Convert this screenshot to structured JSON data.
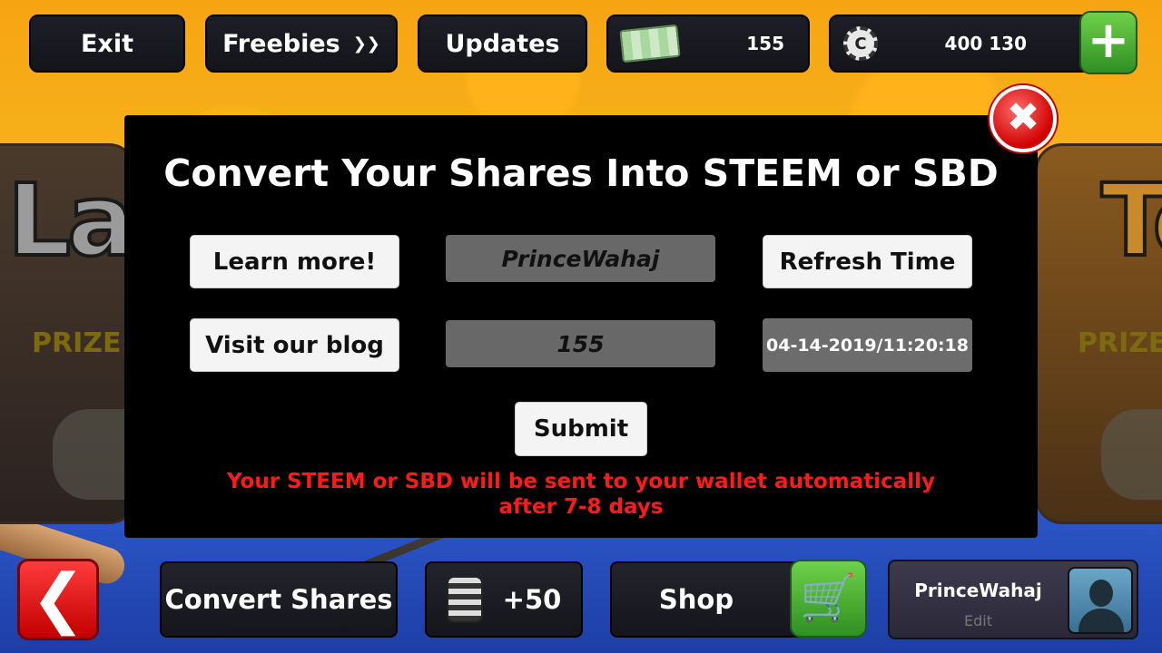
{
  "top_bar": {
    "exit_label": "Exit",
    "freebies_label": "Freebies",
    "updates_label": "Updates",
    "cash_amount": "155",
    "coin_amount": "400 130",
    "plus_symbol": "+",
    "coin_glyph": "C"
  },
  "background": {
    "left_panel_text": "Las",
    "right_panel_text": "To",
    "prize_label": "PRIZE:"
  },
  "modal": {
    "title": "Convert Your Shares Into STEEM or SBD",
    "learn_more_label": "Learn more!",
    "visit_blog_label": "Visit our blog",
    "refresh_time_label": "Refresh Time",
    "username_value": "PrinceWahaj",
    "shares_value": "155",
    "timestamp_value": "04-14-2019/11:20:18",
    "submit_label": "Submit",
    "notice_text": "Your STEEM or SBD will be sent to your wallet automatically after 7-8 days",
    "close_symbol": "✖"
  },
  "bottom_bar": {
    "back_symbol": "❮",
    "convert_shares_label": "Convert Shares",
    "chips_bonus": "+50",
    "shop_label": "Shop",
    "cart_symbol": "🛒",
    "profile_name": "PrinceWahaj",
    "profile_edit": "Edit"
  },
  "colors": {
    "notice_red": "#ff1a1a",
    "accent_green": "#2f8f22",
    "close_red": "#d00000"
  },
  "icons": [
    "cash-icon",
    "coin-icon",
    "plus-icon",
    "close-icon",
    "back-arrow-icon",
    "chip-stack-icon",
    "cart-icon",
    "avatar-icon",
    "chevron-down-icon"
  ]
}
